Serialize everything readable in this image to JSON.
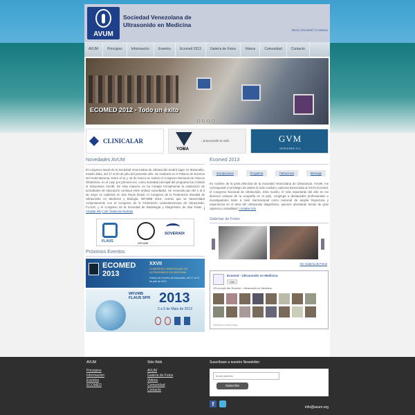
{
  "header": {
    "logo_abbr": "AVUM",
    "org_name": "Sociedad Venezolana de Ultrasonido en Medicina",
    "top_links": "Inicio | Ecomed | Contacto"
  },
  "nav": [
    "AVUM",
    "Principios",
    "Información",
    "Eventos",
    "Ecomed 2013",
    "Galería de Fotos",
    "Videos",
    "Comunidad",
    "Contacto"
  ],
  "hero": {
    "caption": "ECOMED 2012 - Todo un éxito"
  },
  "sponsors": [
    "CLINICALAR",
    "YOMA",
    "...procurando tu vida",
    "GVM",
    "GESVEMED S.A."
  ],
  "news": {
    "title": "Novedades AVUM",
    "body": "El congreso anual de la Sociedad Venezolana de Ultrasonido tendrá lugar en Maracaibo, estado Zulia, del 17 al 20 de julio del presente año. Se realizará en el Palacio de Eventos del Hotel Maruma. Entre el 11 y 15 de marzo se realizó el Congreso Nacional de Ginecio Obstetricia, en el cual, por primera vez, como actividad principal del programa fue incluido el Simposium AVUM. De esta manera, se ha iniciado formalmente la realización de actividades de educación continua entre ambas sociedades. Se recuerda que del 1 al 5 de mayo se realizará en San Paulo Brasil, el Congreso de la Federación Mundial de Ultrasonido en Medicina y Biología, WFUMB 2013, evento que se desarrollará conjuntamente con el Congreso de la Federación Latinoamericana de Ultrasonido, FLAUS, y el Congreso de la Sociedad de Radiología y Diagnóstico de Sao Paulo.",
    "more": "| Ampliar info",
    "all": "| Ver Todas las Noticias"
  },
  "partners": [
    "FLAUS",
    "WFUMB",
    "SOVERADI"
  ],
  "events": {
    "title": "Próximos Eventos",
    "ecomed_title": "ECOMED 2013",
    "ecomed_sub": "XXVII",
    "ecomed_desc": "CONGRESO VENEZOLANO DE ULTRASONIDO EN MEDICINA",
    "ecomed_place": "Palacio de Eventos de Maracaibo, del 17 al 20 de julio de 2013",
    "wfumb_title": "WFUMB FLAUS SPR",
    "wfumb_year": "2013",
    "wfumb_dates": "2 a 5 de Maio de 2013"
  },
  "ecomed": {
    "title": "Ecomed 2013",
    "tabs": [
      "Inscripciones",
      "Programa",
      "Patrocinios",
      "Mensaje"
    ],
    "body": "En nombre de la junta directiva de la Sociedad Venezolana de Ultrasonido, AVUM, me corresponde el privilegio de darles la más cordial y calurosa bienvenida al XXVII Ecomed, el Congreso Nacional de Ultrasonido. Este evento, el más importante del año en los diversos campos de la ecografía en el país, congrega a destacados profesionales e investigadores tanto a nivel internacional como nacional de amplia trayectoria y experiencia en el área del ultrasonido diagnóstico, quienes abordarán temas de gran vigencia y actualidad.",
    "more": "| Ampliar info"
  },
  "gallery": {
    "title": "Galerías de Fotos",
    "link": "Ver Galería de Fotos"
  },
  "facebook": {
    "page": "Ecomed - Ultrasonido en Medicina",
    "like": "Like",
    "count": "224 people like Ecomed - Ultrasonido en Medicina.",
    "plugin": "Facebook social plugin"
  },
  "footer": {
    "col1_title": "AVUM",
    "col1": [
      "Principios",
      "Información",
      "Eventos",
      "ECOMED"
    ],
    "col2_title": "Sitio Web",
    "col2": [
      "AVUM",
      "Galería de Fotos",
      "Videos",
      "Comunidad",
      "Contacto"
    ],
    "newsletter_title": "Suscríbase a nuestro Newsletter",
    "email_placeholder": "email address",
    "subscribe": "Subscribe",
    "email": "info@avum.org"
  }
}
